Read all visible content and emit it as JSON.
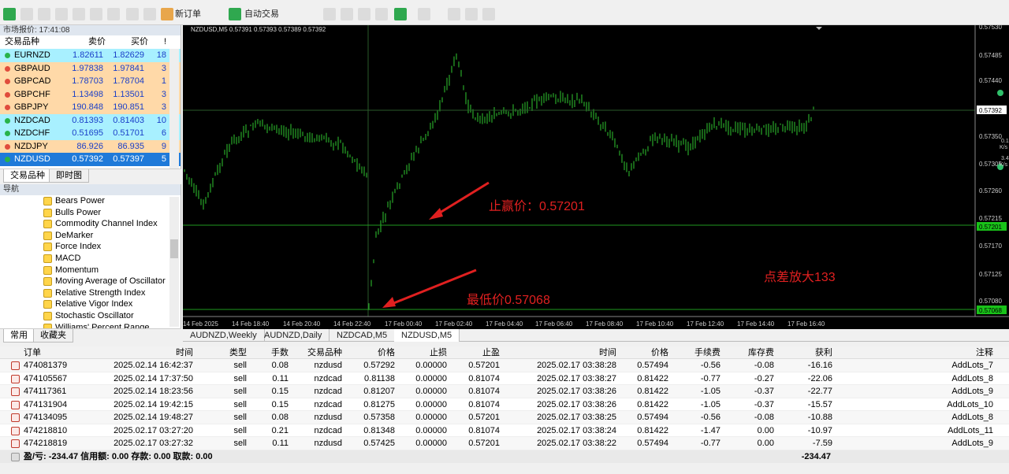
{
  "market_watch": {
    "title": "市场报价: 17:41:08",
    "headers": {
      "symbol": "交易品种",
      "bid": "卖价",
      "ask": "买价",
      "spread": "!"
    },
    "rows": [
      {
        "symbol": "EURNZD",
        "bid": "1.82611",
        "ask": "1.82629",
        "spread": "18",
        "bg": "#a8f0ff",
        "dot": "#28b34a"
      },
      {
        "symbol": "GBPAUD",
        "bid": "1.97838",
        "ask": "1.97841",
        "spread": "3",
        "bg": "#ffd9a8",
        "dot": "#e04c3c"
      },
      {
        "symbol": "GBPCAD",
        "bid": "1.78703",
        "ask": "1.78704",
        "spread": "1",
        "bg": "#ffd9a8",
        "dot": "#e04c3c"
      },
      {
        "symbol": "GBPCHF",
        "bid": "1.13498",
        "ask": "1.13501",
        "spread": "3",
        "bg": "#ffd9a8",
        "dot": "#e04c3c"
      },
      {
        "symbol": "GBPJPY",
        "bid": "190.848",
        "ask": "190.851",
        "spread": "3",
        "bg": "#ffd9a8",
        "dot": "#e04c3c"
      },
      {
        "symbol": "NZDCAD",
        "bid": "0.81393",
        "ask": "0.81403",
        "spread": "10",
        "bg": "#a8f0ff",
        "dot": "#28b34a"
      },
      {
        "symbol": "NZDCHF",
        "bid": "0.51695",
        "ask": "0.51701",
        "spread": "6",
        "bg": "#a8f0ff",
        "dot": "#28b34a"
      },
      {
        "symbol": "NZDJPY",
        "bid": "86.926",
        "ask": "86.935",
        "spread": "9",
        "bg": "#ffd9a8",
        "dot": "#e04c3c"
      },
      {
        "symbol": "NZDUSD",
        "bid": "0.57392",
        "ask": "0.57397",
        "spread": "5",
        "bg": "#1f7ad9",
        "dot": "#28b34a",
        "selected": true
      }
    ],
    "tabs": [
      "交易品种",
      "即时图"
    ]
  },
  "navigator": {
    "title": "导航",
    "items": [
      "Bears Power",
      "Bulls Power",
      "Commodity Channel Index",
      "DeMarker",
      "Force Index",
      "MACD",
      "Momentum",
      "Moving Average of Oscillator",
      "Relative Strength Index",
      "Relative Vigor Index",
      "Stochastic Oscillator",
      "Williams' Percent Range"
    ],
    "tabs": [
      "常用",
      "收藏夹"
    ]
  },
  "toolbar": {
    "new_order": "新订单",
    "autotrading": "自动交易"
  },
  "chart": {
    "title": "NZDUSD,M5  0.57391 0.57393 0.57389 0.57392",
    "price_labels": [
      "0.57530",
      "0.57485",
      "0.57440",
      "0.57392",
      "0.57350",
      "0.57305",
      "0.57260",
      "0.57215",
      "0.57201",
      "0.57170",
      "0.57125",
      "0.57080",
      "0.57068"
    ],
    "time_labels": [
      "14 Feb 2025",
      "14 Feb 18:40",
      "14 Feb 20:40",
      "14 Feb 22:40",
      "17 Feb 00:40",
      "17 Feb 02:40",
      "17 Feb 04:40",
      "17 Feb 06:40",
      "17 Feb 08:40",
      "17 Feb 10:40",
      "17 Feb 12:40",
      "17 Feb 14:40",
      "17 Feb 16:40"
    ],
    "annotation_tp": "止赢价：0.57201",
    "annotation_low": "最低价0.57068",
    "annotation_spread": "点差放大133",
    "side_info": {
      "speed": "0.1",
      "unit": "K/s",
      "speed2": "3.4",
      "unit2": "K/s"
    }
  },
  "chart_tabs": [
    "AUDNZD,Weekly",
    "AUDNZD,Daily",
    "NZDCAD,M5",
    "NZDUSD,M5"
  ],
  "orders": {
    "headers": [
      "订单",
      "时间",
      "类型",
      "手数",
      "交易品种",
      "价格",
      "止损",
      "止盈",
      "时间",
      "价格",
      "手续费",
      "库存费",
      "获利",
      "注释"
    ],
    "rows": [
      [
        "474081379",
        "2025.02.14 16:42:37",
        "sell",
        "0.08",
        "nzdusd",
        "0.57292",
        "0.00000",
        "0.57201",
        "2025.02.17 03:38:28",
        "0.57494",
        "-0.56",
        "-0.08",
        "-16.16",
        "AddLots_7"
      ],
      [
        "474105567",
        "2025.02.14 17:37:50",
        "sell",
        "0.11",
        "nzdcad",
        "0.81138",
        "0.00000",
        "0.81074",
        "2025.02.17 03:38:27",
        "0.81422",
        "-0.77",
        "-0.27",
        "-22.06",
        "AddLots_8"
      ],
      [
        "474117361",
        "2025.02.14 18:23:56",
        "sell",
        "0.15",
        "nzdcad",
        "0.81207",
        "0.00000",
        "0.81074",
        "2025.02.17 03:38:26",
        "0.81422",
        "-1.05",
        "-0.37",
        "-22.77",
        "AddLots_9"
      ],
      [
        "474131904",
        "2025.02.14 19:42:15",
        "sell",
        "0.15",
        "nzdcad",
        "0.81275",
        "0.00000",
        "0.81074",
        "2025.02.17 03:38:26",
        "0.81422",
        "-1.05",
        "-0.37",
        "-15.57",
        "AddLots_10"
      ],
      [
        "474134095",
        "2025.02.14 19:48:27",
        "sell",
        "0.08",
        "nzdusd",
        "0.57358",
        "0.00000",
        "0.57201",
        "2025.02.17 03:38:25",
        "0.57494",
        "-0.56",
        "-0.08",
        "-10.88",
        "AddLots_8"
      ],
      [
        "474218810",
        "2025.02.17 03:27:20",
        "sell",
        "0.21",
        "nzdcad",
        "0.81348",
        "0.00000",
        "0.81074",
        "2025.02.17 03:38:24",
        "0.81422",
        "-1.47",
        "0.00",
        "-10.97",
        "AddLots_11"
      ],
      [
        "474218819",
        "2025.02.17 03:27:32",
        "sell",
        "0.11",
        "nzdusd",
        "0.57425",
        "0.00000",
        "0.57201",
        "2025.02.17 03:38:22",
        "0.57494",
        "-0.77",
        "0.00",
        "-7.59",
        "AddLots_9"
      ]
    ],
    "summary": "盈/亏: -234.47  信用额: 0.00  存款: 0.00  取款: 0.00",
    "total": "-234.47"
  }
}
